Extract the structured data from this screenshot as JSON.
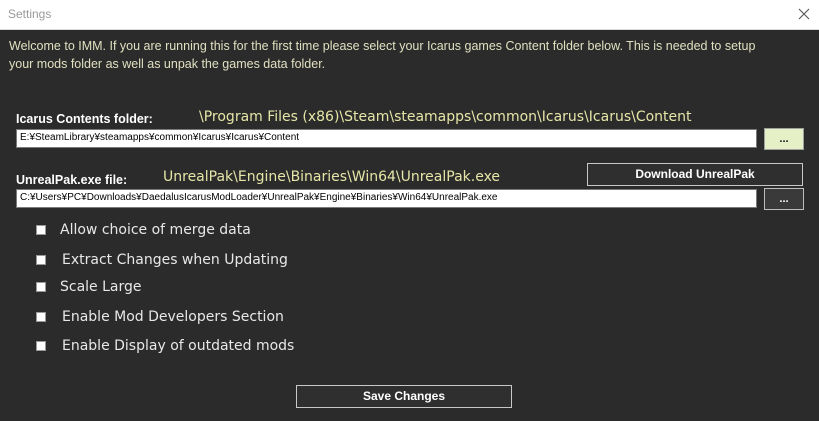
{
  "window": {
    "title": "Settings",
    "close_icon": "close-icon"
  },
  "welcome_text": "Welcome to IMM. If you are running this for the first time please select your Icarus games Content folder below. This is needed to setup your mods folder as well as unpak the games data folder.",
  "icarus_contents": {
    "label": "Icarus Contents folder:",
    "display_path": "\\Program Files (x86)\\Steam\\steamapps\\common\\Icarus\\Icarus\\Content",
    "value": "E:¥SteamLibrary¥steamapps¥common¥Icarus¥Icarus¥Content",
    "browse_label": "..."
  },
  "unrealpak": {
    "label": "UnrealPak.exe file:",
    "display_path": "UnrealPak\\Engine\\Binaries\\Win64\\UnrealPak.exe",
    "value": "C:¥Users¥PC¥Downloads¥DaedalusIcarusModLoader¥UnrealPak¥Engine¥Binaries¥Win64¥UnrealPak.exe",
    "browse_label": "...",
    "download_label": "Download UnrealPak"
  },
  "options": [
    {
      "label": "Allow choice of merge data",
      "checked": false
    },
    {
      "label": "Extract Changes when Updating",
      "checked": false
    },
    {
      "label": "Scale Large",
      "checked": false
    },
    {
      "label": "Enable Mod Developers Section",
      "checked": false
    },
    {
      "label": "Enable Display of outdated mods",
      "checked": false
    }
  ],
  "save_label": "Save Changes",
  "colors": {
    "background": "#2b2b2b",
    "accent_text": "#e6e6a8",
    "browse_highlight": "#e6f0c6"
  }
}
